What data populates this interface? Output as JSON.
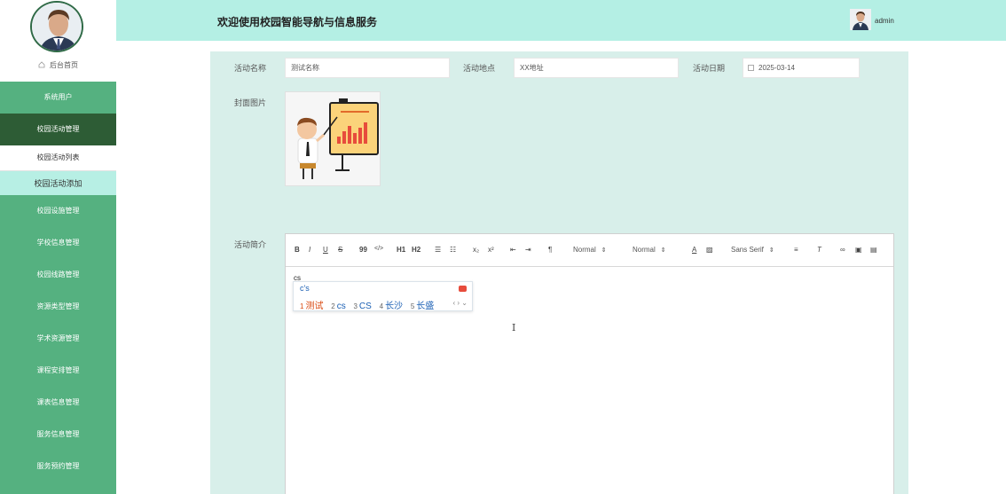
{
  "header": {
    "title": "欢迎使用校园智能导航与信息服务",
    "username": "admin"
  },
  "sidebar": {
    "home_label": "后台首页",
    "items": [
      {
        "label": "系统用户"
      },
      {
        "label": "校园活动管理"
      },
      {
        "label": "校园设施管理"
      },
      {
        "label": "学校信息管理"
      },
      {
        "label": "校园线路管理"
      },
      {
        "label": "资源类型管理"
      },
      {
        "label": "学术资源管理"
      },
      {
        "label": "课程安排管理"
      },
      {
        "label": "课表信息管理"
      },
      {
        "label": "服务信息管理"
      },
      {
        "label": "服务预约管理"
      }
    ],
    "submenu": [
      {
        "label": "校园活动列表"
      },
      {
        "label": "校园活动添加"
      }
    ]
  },
  "form": {
    "name_label": "活动名称",
    "name_value": "测试名称",
    "location_label": "活动地点",
    "location_value": "XX地址",
    "date_label": "活动日期",
    "date_value": "2025-03-14",
    "cover_label": "封面图片",
    "intro_label": "活动简介"
  },
  "editor": {
    "toolbar": {
      "bold": "B",
      "italic": "I",
      "underline": "U",
      "strike": "S",
      "quote": "99",
      "code": "</>",
      "h1": "H1",
      "h2": "H2",
      "sub": "x₂",
      "sup": "x²",
      "size_select": "Normal",
      "header_select": "Normal",
      "font_select": "Sans Serif"
    },
    "typed_text": "cs",
    "ime": {
      "composition": "c's",
      "candidates": [
        {
          "n": "1",
          "text": "测试"
        },
        {
          "n": "2",
          "text": "cs"
        },
        {
          "n": "3",
          "text": "CS"
        },
        {
          "n": "4",
          "text": "长沙"
        },
        {
          "n": "5",
          "text": "长盛"
        }
      ]
    }
  },
  "colors": {
    "sidebar": "#55b180",
    "sidebar_active": "#2d5c35",
    "header": "#b4efe4",
    "panel": "#d8efea",
    "submenu_current": "#b7efe4",
    "ime_highlight": "#d9480f",
    "ime_text": "#1a5fb4"
  }
}
